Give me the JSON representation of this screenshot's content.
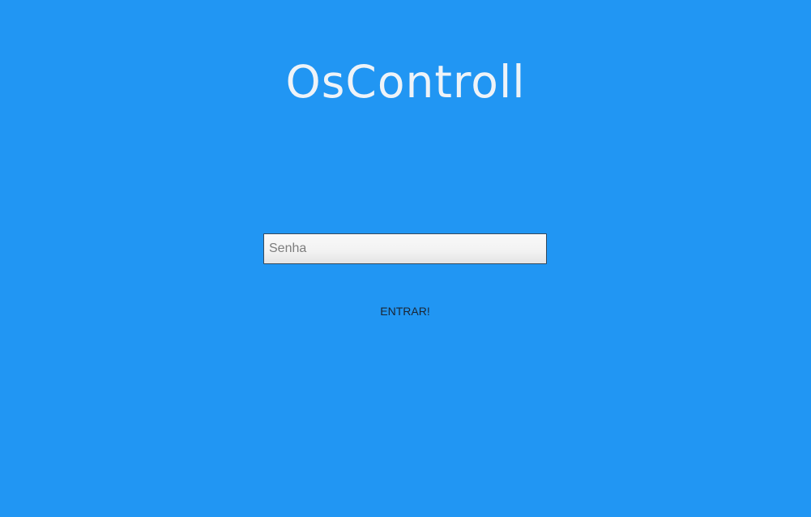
{
  "app": {
    "title": "OsControll"
  },
  "login": {
    "password_placeholder": "Senha",
    "password_value": "",
    "submit_label": "ENTRAR!"
  },
  "colors": {
    "background": "#2196F3",
    "title_text": "#EEF3F8",
    "button_text": "#1A2533"
  }
}
